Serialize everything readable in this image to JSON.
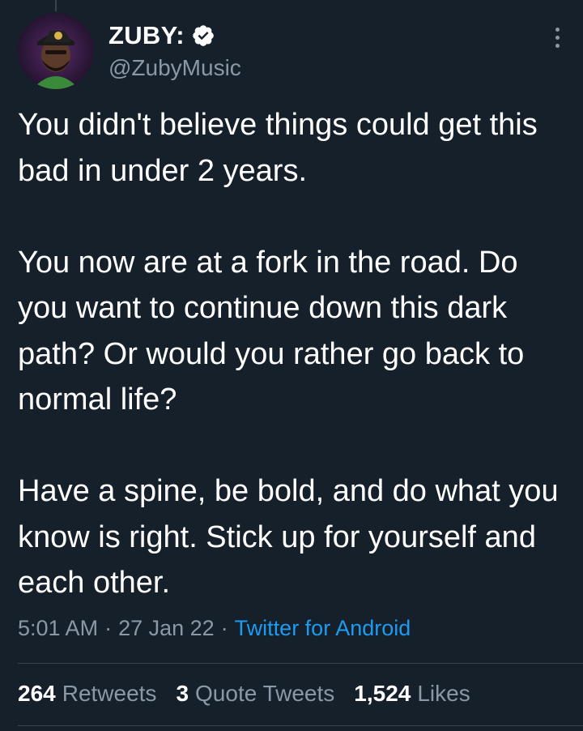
{
  "author": {
    "display_name": "ZUBY:",
    "handle": "@ZubyMusic",
    "verified_icon": "verified-badge-icon",
    "avatar": "avatar"
  },
  "tweet": {
    "paragraphs": [
      "You didn't believe things could get this bad in under 2 years.",
      "You now are at a fork in the road. Do you want to continue down this dark path? Or would you rather go back to normal life?",
      "Have a spine, be bold, and do what you know is right. Stick up for yourself and each other."
    ],
    "time": "5:01 AM",
    "date": "27 Jan 22",
    "separator": "·",
    "source": "Twitter for Android"
  },
  "stats": {
    "retweets_count": "264",
    "retweets_label": "Retweets",
    "quotes_count": "3",
    "quotes_label": "Quote Tweets",
    "likes_count": "1,524",
    "likes_label": "Likes"
  },
  "colors": {
    "background": "#15202b",
    "text": "#ffffff",
    "secondary": "#8b98a5",
    "link": "#1d9bf0",
    "divider": "#38444d"
  }
}
